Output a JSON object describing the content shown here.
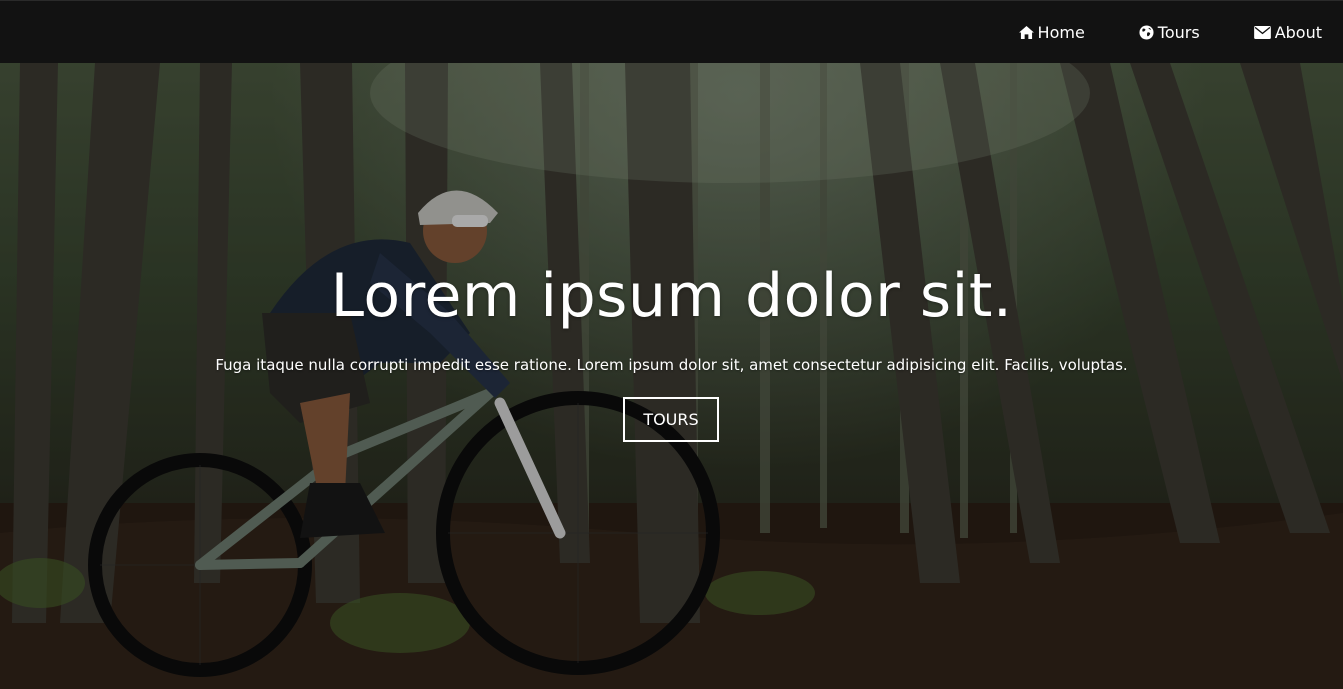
{
  "nav": {
    "items": [
      {
        "label": "Home",
        "icon": "home-icon"
      },
      {
        "label": "Tours",
        "icon": "globe-icon"
      },
      {
        "label": "About",
        "icon": "envelope-icon"
      }
    ]
  },
  "hero": {
    "title": "Lorem ipsum dolor sit.",
    "subtitle": "Fuga itaque nulla corrupti impedit esse ratione. Lorem ipsum dolor sit, amet consectetur adipisicing elit. Facilis, voluptas.",
    "button_label": "TOURS",
    "image": "mountain-biker-in-forest-photo"
  },
  "colors": {
    "navbar": "#121212",
    "text": "#ffffff"
  }
}
